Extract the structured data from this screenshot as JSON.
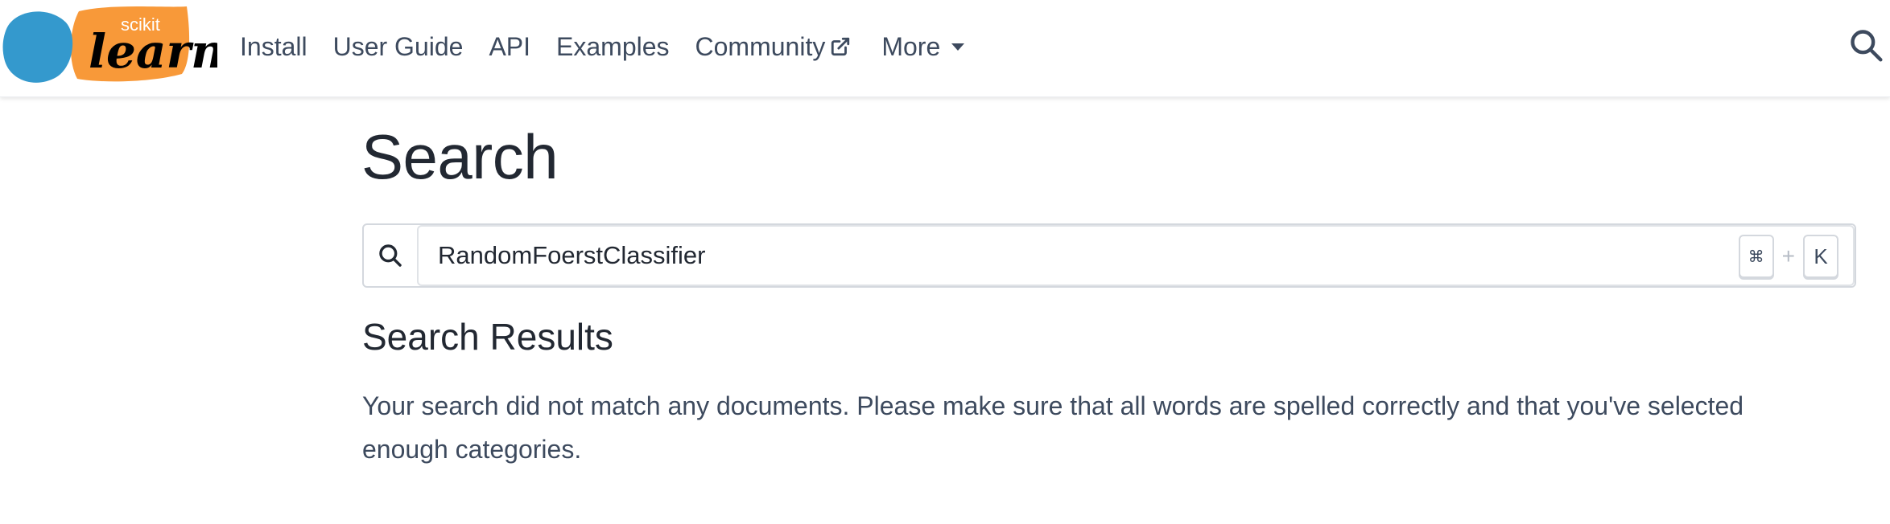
{
  "header": {
    "logo": {
      "top_text": "scikit",
      "main_text": "learn",
      "colors": {
        "blue": "#3499cd",
        "orange": "#f89939",
        "ink": "#010101",
        "white": "#ffffff"
      }
    },
    "nav": [
      {
        "label": "Install"
      },
      {
        "label": "User Guide"
      },
      {
        "label": "API"
      },
      {
        "label": "Examples"
      },
      {
        "label": "Community",
        "icon": "external-link-icon"
      },
      {
        "label": "More",
        "icon": "caret-down-icon"
      }
    ],
    "search_icon": "search-icon"
  },
  "main": {
    "title": "Search",
    "search": {
      "value": "RandomFoerstClassifier",
      "icon": "search-icon",
      "shortcut": {
        "key1": "⌘",
        "plus": "+",
        "key2": "K"
      }
    },
    "results_heading": "Search Results",
    "results_message": "Your search did not match any documents. Please make sure that all words are spelled correctly and that you've selected enough categories."
  },
  "colors": {
    "text": "#222832",
    "muted_text": "#3d4a5e",
    "border": "#d4d8de"
  }
}
